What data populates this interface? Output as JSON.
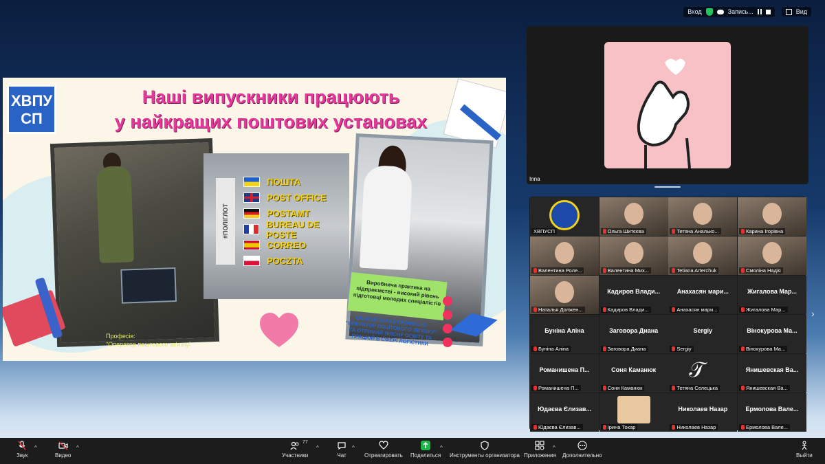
{
  "top_bar": {
    "enter_label": "Вход",
    "record_label": "Запись...",
    "view_label": "Вид"
  },
  "slide": {
    "logo_text": "ХВПУ СП",
    "title_line1": "Наші випускники працюють",
    "title_line2": "у найкращих поштових установах",
    "hashtag": "#ПОЛІГЛОТ",
    "post_words": [
      {
        "word": "ПОШТА",
        "flag": "ukraine"
      },
      {
        "word": "POST OFFICE",
        "flag": "uk"
      },
      {
        "word": "POSTAMT",
        "flag": "germany"
      },
      {
        "word": "BUREAU DE POSTE",
        "flag": "france"
      },
      {
        "word": "CORREO",
        "flag": "spain"
      },
      {
        "word": "POCZTA",
        "flag": "poland"
      }
    ],
    "caption_left": "Професія:\n\"Оператор поштового зв'язку\"",
    "green_box": "Виробнича практика на підприємстві - високий рівень підготовці молодих спеціалістів",
    "blue_note": "ОБИРАЙ ЗАРАЗ ПРОФЕСІЮ: \"ОПЕРАТОР ПОШТОВОГО ЗВ'ЯЗКУ\" ТА ОТРИМАЙ ЯКІСНУ ОСВІТУ ТА ПРАЦЮЙ В СФЕРІ ЛОГІСТИКИ"
  },
  "speaker": {
    "name": "Inna"
  },
  "gallery": [
    {
      "kind": "logo",
      "big": "",
      "label": "ХВПУСП",
      "muted": false
    },
    {
      "kind": "video",
      "big": "",
      "label": "Ольга Шитєєва",
      "muted": true
    },
    {
      "kind": "video",
      "big": "",
      "label": "Тетяна Аналько...",
      "muted": true
    },
    {
      "kind": "video",
      "big": "",
      "label": "Карина Ігорівна",
      "muted": true
    },
    {
      "kind": "video",
      "big": "",
      "label": "Валентина Роле...",
      "muted": true
    },
    {
      "kind": "video",
      "big": "",
      "label": "Валентина Мих...",
      "muted": true
    },
    {
      "kind": "video",
      "big": "",
      "label": "Tetiana Arterchuk",
      "muted": true
    },
    {
      "kind": "video",
      "big": "",
      "label": "Смоліна Надія",
      "muted": true
    },
    {
      "kind": "video",
      "big": "",
      "label": "Наталья Должен...",
      "muted": true
    },
    {
      "kind": "name",
      "big": "Кадиров Влади...",
      "label": "Кадиров Влади...",
      "muted": true
    },
    {
      "kind": "name",
      "big": "Анахасян мари...",
      "label": "Анахасян мари...",
      "muted": true
    },
    {
      "kind": "name",
      "big": "Жигалова Мар...",
      "label": "Жигалова Мар...",
      "muted": true
    },
    {
      "kind": "name",
      "big": "Буніна Аліна",
      "label": "Буніна Аліна",
      "muted": true
    },
    {
      "kind": "name",
      "big": "Заговора Диана",
      "label": "Заговора Диана",
      "muted": true
    },
    {
      "kind": "name",
      "big": "Sergiy",
      "label": "Sergiy",
      "muted": true
    },
    {
      "kind": "name",
      "big": "Вінокурова Ма...",
      "label": "Вінокурова Ма...",
      "muted": true
    },
    {
      "kind": "name",
      "big": "Романишена П...",
      "label": "Романишена П...",
      "muted": true
    },
    {
      "kind": "name",
      "big": "Соня Каманюк",
      "label": "Соня Каманюк",
      "muted": true
    },
    {
      "kind": "mono",
      "big": "",
      "label": "Тетяна Селецька",
      "muted": true
    },
    {
      "kind": "name",
      "big": "Янишевская Ва...",
      "label": "Янишевская Ва...",
      "muted": true
    },
    {
      "kind": "name",
      "big": "Юдаєва Єлизав...",
      "label": "Юдаєва Єлизав...",
      "muted": true
    },
    {
      "kind": "avatar",
      "big": "",
      "label": "Ірина Токар",
      "muted": true
    },
    {
      "kind": "name",
      "big": "Николаев Назар",
      "label": "Николаев Назар",
      "muted": true
    },
    {
      "kind": "name",
      "big": "Ермолова Вале...",
      "label": "Ермолова Вале...",
      "muted": true
    }
  ],
  "toolbar": {
    "audio": "Звук",
    "video": "Видео",
    "participants": "Участники",
    "participants_count": "77",
    "chat": "Чат",
    "react": "Отреагировать",
    "share": "Поделиться",
    "host_tools": "Инструменты организатора",
    "apps": "Приложения",
    "more": "Дополнительно",
    "leave": "Выйти"
  }
}
